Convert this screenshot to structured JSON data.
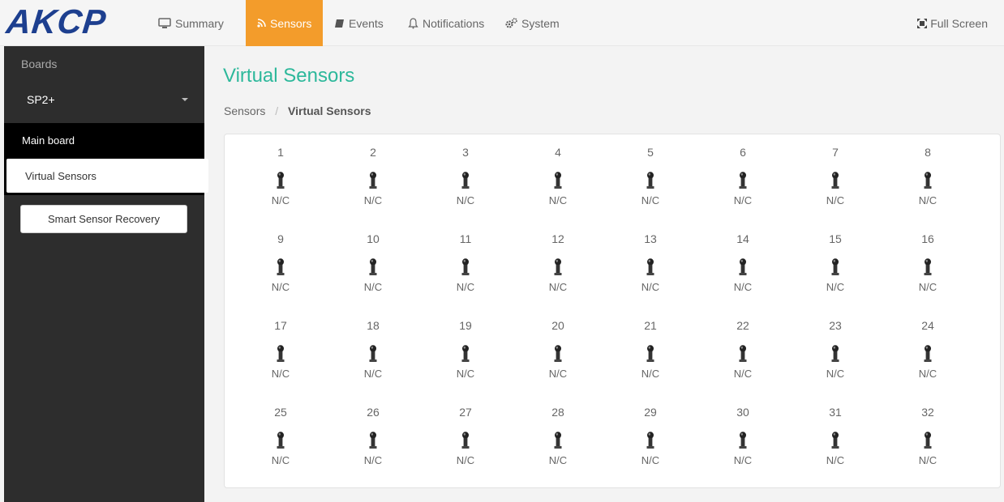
{
  "brand": {
    "logo_text": "AKCP"
  },
  "nav": {
    "items": [
      {
        "label": "Summary",
        "icon": "monitor-icon"
      },
      {
        "label": "Sensors",
        "icon": "rss-icon",
        "active": true
      },
      {
        "label": "Events",
        "icon": "book-icon"
      },
      {
        "label": "Notifications",
        "icon": "bell-icon"
      },
      {
        "label": "System",
        "icon": "cogs-icon"
      }
    ],
    "fullscreen_label": "Full Screen"
  },
  "sidebar": {
    "boards_label": "Boards",
    "selected_board": "SP2+",
    "main_board_label": "Main board",
    "virtual_sensors_label": "Virtual Sensors",
    "recovery_button_label": "Smart Sensor Recovery"
  },
  "page": {
    "title": "Virtual Sensors",
    "breadcrumb": {
      "parent": "Sensors",
      "separator": "/",
      "current": "Virtual Sensors"
    }
  },
  "sensors": [
    {
      "num": "1",
      "status": "N/C"
    },
    {
      "num": "2",
      "status": "N/C"
    },
    {
      "num": "3",
      "status": "N/C"
    },
    {
      "num": "4",
      "status": "N/C"
    },
    {
      "num": "5",
      "status": "N/C"
    },
    {
      "num": "6",
      "status": "N/C"
    },
    {
      "num": "7",
      "status": "N/C"
    },
    {
      "num": "8",
      "status": "N/C"
    },
    {
      "num": "9",
      "status": "N/C"
    },
    {
      "num": "10",
      "status": "N/C"
    },
    {
      "num": "11",
      "status": "N/C"
    },
    {
      "num": "12",
      "status": "N/C"
    },
    {
      "num": "13",
      "status": "N/C"
    },
    {
      "num": "14",
      "status": "N/C"
    },
    {
      "num": "15",
      "status": "N/C"
    },
    {
      "num": "16",
      "status": "N/C"
    },
    {
      "num": "17",
      "status": "N/C"
    },
    {
      "num": "18",
      "status": "N/C"
    },
    {
      "num": "19",
      "status": "N/C"
    },
    {
      "num": "20",
      "status": "N/C"
    },
    {
      "num": "21",
      "status": "N/C"
    },
    {
      "num": "22",
      "status": "N/C"
    },
    {
      "num": "23",
      "status": "N/C"
    },
    {
      "num": "24",
      "status": "N/C"
    },
    {
      "num": "25",
      "status": "N/C"
    },
    {
      "num": "26",
      "status": "N/C"
    },
    {
      "num": "27",
      "status": "N/C"
    },
    {
      "num": "28",
      "status": "N/C"
    },
    {
      "num": "29",
      "status": "N/C"
    },
    {
      "num": "30",
      "status": "N/C"
    },
    {
      "num": "31",
      "status": "N/C"
    },
    {
      "num": "32",
      "status": "N/C"
    }
  ],
  "colors": {
    "accent": "#f39c2b",
    "title": "#2db89b",
    "sidebar_bg": "#2d2d2d",
    "logo": "#1d3f8f"
  }
}
